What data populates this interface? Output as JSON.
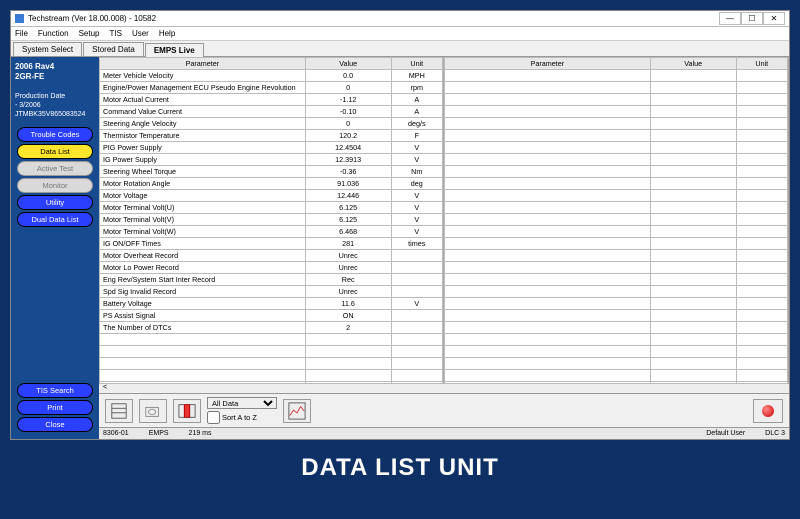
{
  "caption": "DATA LIST UNIT",
  "title": "Techstream (Ver 18.00.008) - 10582",
  "menu": [
    "File",
    "Function",
    "Setup",
    "TIS",
    "User",
    "Help"
  ],
  "tabs": [
    "System Select",
    "Stored Data",
    "EMPS Live"
  ],
  "activeTab": 2,
  "vehicle": {
    "name": "2006 Rav4",
    "engine": "2GR-FE",
    "pd_label": "Production Date",
    "pd_value": "- 3/2006",
    "vin": "JTMBK35V865083524"
  },
  "sideTop": [
    {
      "label": "Trouble Codes",
      "cls": "blue"
    },
    {
      "label": "Data List",
      "cls": "yellow"
    },
    {
      "label": "Active Test",
      "cls": "grey"
    },
    {
      "label": "Monitor",
      "cls": "grey"
    },
    {
      "label": "Utility",
      "cls": "blue"
    },
    {
      "label": "Dual Data List",
      "cls": "blue"
    }
  ],
  "sideBottom": [
    {
      "label": "TIS Search",
      "cls": "blue"
    },
    {
      "label": "Print",
      "cls": "blue"
    },
    {
      "label": "Close",
      "cls": "blue"
    }
  ],
  "cols": [
    "Parameter",
    "Value",
    "Unit"
  ],
  "rows": [
    {
      "p": "Meter Vehicle Velocity",
      "v": "0.0",
      "u": "MPH"
    },
    {
      "p": "Engine/Power Management ECU Pseudo Engine Revolution",
      "v": "0",
      "u": "rpm"
    },
    {
      "p": "Motor Actual Current",
      "v": "-1.12",
      "u": "A"
    },
    {
      "p": "Command Value Current",
      "v": "-0.10",
      "u": "A"
    },
    {
      "p": "Steering Angle Velocity",
      "v": "0",
      "u": "deg/s"
    },
    {
      "p": "Thermistor Temperature",
      "v": "120.2",
      "u": "F"
    },
    {
      "p": "PIG Power Supply",
      "v": "12.4504",
      "u": "V"
    },
    {
      "p": "IG Power Supply",
      "v": "12.3913",
      "u": "V"
    },
    {
      "p": "Steering Wheel Torque",
      "v": "-0.36",
      "u": "Nm"
    },
    {
      "p": "Motor Rotation Angle",
      "v": "91.036",
      "u": "deg"
    },
    {
      "p": "Motor Voltage",
      "v": "12.446",
      "u": "V"
    },
    {
      "p": "Motor Terminal Volt(U)",
      "v": "6.125",
      "u": "V"
    },
    {
      "p": "Motor Terminal Volt(V)",
      "v": "6.125",
      "u": "V"
    },
    {
      "p": "Motor Terminal Volt(W)",
      "v": "6.468",
      "u": "V"
    },
    {
      "p": "IG ON/OFF Times",
      "v": "281",
      "u": "times"
    },
    {
      "p": "Motor Overheat Record",
      "v": "Unrec",
      "u": ""
    },
    {
      "p": "Motor Lo Power Record",
      "v": "Unrec",
      "u": ""
    },
    {
      "p": "Eng Rev/System Start Inter Record",
      "v": "Rec",
      "u": ""
    },
    {
      "p": "Spd Sig Invalid Record",
      "v": "Unrec",
      "u": ""
    },
    {
      "p": "Battery Voltage",
      "v": "11.6",
      "u": "V"
    },
    {
      "p": "PS Assist Signal",
      "v": "ON",
      "u": ""
    },
    {
      "p": "The Number of DTCs",
      "v": "2",
      "u": ""
    }
  ],
  "blankRows": 8,
  "toolbar": {
    "filter": "All Data",
    "sort": "Sort A to Z"
  },
  "status": {
    "l1": "8306-01",
    "l2": "EMPS",
    "l3": "219 ms",
    "r1": "Default User",
    "r2": "DLC 3"
  }
}
